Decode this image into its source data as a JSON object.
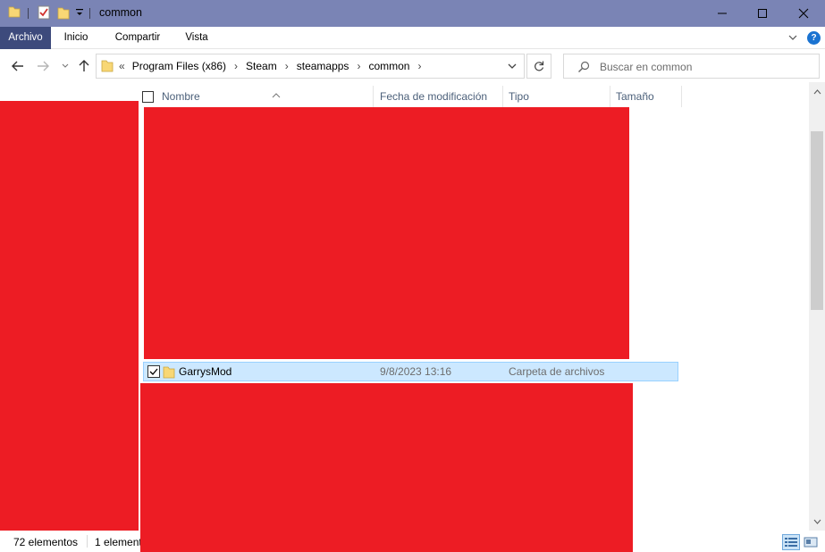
{
  "window": {
    "title": "common"
  },
  "ribbon": {
    "tabs": [
      "Archivo",
      "Inicio",
      "Compartir",
      "Vista"
    ],
    "help_label": "?"
  },
  "navigation": {
    "overflow_label": "«",
    "breadcrumbs": [
      "Program Files (x86)",
      "Steam",
      "steamapps",
      "common"
    ],
    "search_placeholder": "Buscar en common"
  },
  "columns": [
    "Nombre",
    "Fecha de modificación",
    "Tipo",
    "Tamaño"
  ],
  "selected_row": {
    "name": "GarrysMod",
    "date": "9/8/2023 13:16",
    "type": "Carpeta de archivos",
    "checked": true
  },
  "status": {
    "item_count": "72 elementos",
    "selected_count": "1 elemento"
  },
  "colors": {
    "titlebar": "#7a84b5",
    "active_tab": "#3d4a7c",
    "selection": "#cce8ff",
    "redaction": "#ed1c24",
    "folder": "#f8d775"
  }
}
